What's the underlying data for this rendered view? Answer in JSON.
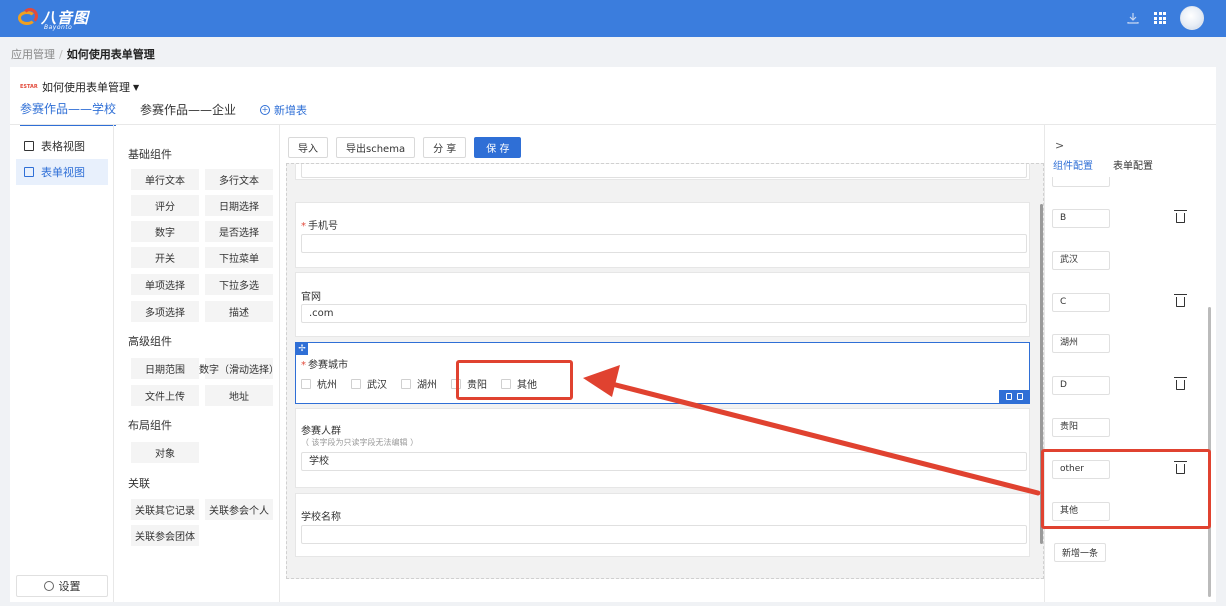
{
  "topbar": {
    "logo_text": "八音图",
    "logo_sub": "Bayonto",
    "accent_color": "#3b7ddd"
  },
  "breadcrumb": {
    "root": "应用管理",
    "current": "如何使用表单管理"
  },
  "app": {
    "name": "如何使用表单管理",
    "badge": "ESTAR"
  },
  "tabs": [
    {
      "label": "参赛作品——学校",
      "active": true
    },
    {
      "label": "参赛作品——企业",
      "active": false
    }
  ],
  "add_table_label": "新增表",
  "leftnav": {
    "items": [
      {
        "label": "表格视图",
        "icon": "table-icon",
        "active": false
      },
      {
        "label": "表单视图",
        "icon": "edit-icon",
        "active": true
      }
    ],
    "settings_label": "设置"
  },
  "palette": {
    "basic_title": "基础组件",
    "basic": [
      "单行文本",
      "多行文本",
      "评分",
      "日期选择",
      "数字",
      "是否选择",
      "开关",
      "下拉菜单",
      "单项选择",
      "下拉多选",
      "多项选择",
      "描述"
    ],
    "advanced_title": "高级组件",
    "advanced": [
      "日期范围",
      "数字（滑动选择）",
      "文件上传",
      "地址"
    ],
    "layout_title": "布局组件",
    "layout": [
      "对象"
    ],
    "relation_title": "关联",
    "relation": [
      "关联其它记录",
      "关联参会个人",
      "关联参会团体"
    ]
  },
  "toolbar": {
    "import": "导入",
    "export_schema": "导出schema",
    "share": "分 享",
    "save": "保 存"
  },
  "form": {
    "phone_label": "手机号",
    "website_label": "官网",
    "website_value": ".com",
    "city_label": "参赛城市",
    "city_options": [
      "杭州",
      "武汉",
      "湖州",
      "贵阳",
      "其他"
    ],
    "crowd_label": "参赛人群",
    "crowd_hint": "（ 该字段为只读字段无法编辑 ）",
    "crowd_value": "学校",
    "school_label": "学校名称"
  },
  "config": {
    "tab_component": "组件配置",
    "tab_form": "表单配置",
    "options": [
      {
        "key": "B",
        "value": "武汉"
      },
      {
        "key": "C",
        "value": "湖州"
      },
      {
        "key": "D",
        "value": "贵阳"
      },
      {
        "key": "other",
        "value": "其他"
      }
    ],
    "add_label": "新增一条"
  },
  "annotation_color": "#e04230"
}
